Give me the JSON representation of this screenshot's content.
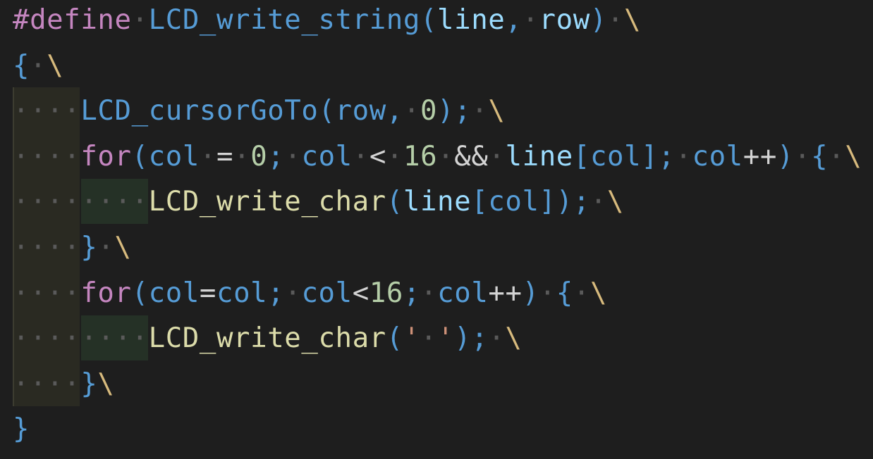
{
  "colors": {
    "background": "#1e1e1e",
    "keyword": "#c586c0",
    "function": "#dcdcaa",
    "variable": "#9cdcfe",
    "variable_alt": "#569cd6",
    "number": "#b5cea8",
    "string": "#ce9178",
    "operator": "#d4d4d4",
    "escape": "#d7ba7d",
    "whitespace_dot": "#5a5a5a",
    "indent_guide_1": "#2a2a22",
    "indent_guide_2": "#253126"
  },
  "code": {
    "lines": [
      {
        "tokens": [
          {
            "t": "#define",
            "c": "keyword"
          },
          {
            "t": "·",
            "c": "ws"
          },
          {
            "t": "LCD_write_string",
            "c": "variable_alt"
          },
          {
            "t": "(",
            "c": "variable_alt"
          },
          {
            "t": "line",
            "c": "variable"
          },
          {
            "t": ",",
            "c": "variable_alt"
          },
          {
            "t": "·",
            "c": "ws"
          },
          {
            "t": "row",
            "c": "variable"
          },
          {
            "t": ")",
            "c": "variable_alt"
          },
          {
            "t": "·",
            "c": "ws"
          },
          {
            "t": "\\",
            "c": "escape"
          }
        ]
      },
      {
        "tokens": [
          {
            "t": "{",
            "c": "variable_alt"
          },
          {
            "t": "·",
            "c": "ws"
          },
          {
            "t": "\\",
            "c": "escape"
          }
        ]
      },
      {
        "tokens": [
          {
            "t": "····",
            "c": "ws"
          },
          {
            "t": "LCD_cursorGoTo",
            "c": "variable_alt"
          },
          {
            "t": "(",
            "c": "variable_alt"
          },
          {
            "t": "row",
            "c": "variable_alt"
          },
          {
            "t": ",",
            "c": "variable_alt"
          },
          {
            "t": "·",
            "c": "ws"
          },
          {
            "t": "0",
            "c": "number"
          },
          {
            "t": ");",
            "c": "variable_alt"
          },
          {
            "t": "·",
            "c": "ws"
          },
          {
            "t": "\\",
            "c": "escape"
          }
        ]
      },
      {
        "tokens": [
          {
            "t": "····",
            "c": "ws"
          },
          {
            "t": "for",
            "c": "keyword"
          },
          {
            "t": "(",
            "c": "variable_alt"
          },
          {
            "t": "col",
            "c": "variable_alt"
          },
          {
            "t": "·",
            "c": "ws"
          },
          {
            "t": "=",
            "c": "operator"
          },
          {
            "t": "·",
            "c": "ws"
          },
          {
            "t": "0",
            "c": "number"
          },
          {
            "t": ";",
            "c": "variable_alt"
          },
          {
            "t": "·",
            "c": "ws"
          },
          {
            "t": "col",
            "c": "variable_alt"
          },
          {
            "t": "·",
            "c": "ws"
          },
          {
            "t": "<",
            "c": "operator"
          },
          {
            "t": "·",
            "c": "ws"
          },
          {
            "t": "16",
            "c": "number"
          },
          {
            "t": "·",
            "c": "ws"
          },
          {
            "t": "&&",
            "c": "operator"
          },
          {
            "t": "·",
            "c": "ws"
          },
          {
            "t": "line",
            "c": "variable"
          },
          {
            "t": "[",
            "c": "variable_alt"
          },
          {
            "t": "col",
            "c": "variable_alt"
          },
          {
            "t": "];",
            "c": "variable_alt"
          },
          {
            "t": "·",
            "c": "ws"
          },
          {
            "t": "col",
            "c": "variable_alt"
          },
          {
            "t": "++",
            "c": "operator"
          },
          {
            "t": ")",
            "c": "variable_alt"
          },
          {
            "t": "·",
            "c": "ws"
          },
          {
            "t": "{",
            "c": "variable_alt"
          },
          {
            "t": "·",
            "c": "ws"
          },
          {
            "t": "\\",
            "c": "escape"
          }
        ]
      },
      {
        "tokens": [
          {
            "t": "········",
            "c": "ws"
          },
          {
            "t": "LCD_write_char",
            "c": "function"
          },
          {
            "t": "(",
            "c": "variable_alt"
          },
          {
            "t": "line",
            "c": "variable"
          },
          {
            "t": "[",
            "c": "variable_alt"
          },
          {
            "t": "col",
            "c": "variable_alt"
          },
          {
            "t": "]);",
            "c": "variable_alt"
          },
          {
            "t": "·",
            "c": "ws"
          },
          {
            "t": "\\",
            "c": "escape"
          }
        ]
      },
      {
        "tokens": [
          {
            "t": "····",
            "c": "ws"
          },
          {
            "t": "}",
            "c": "variable_alt"
          },
          {
            "t": "·",
            "c": "ws"
          },
          {
            "t": "\\",
            "c": "escape"
          }
        ]
      },
      {
        "tokens": [
          {
            "t": "····",
            "c": "ws"
          },
          {
            "t": "for",
            "c": "keyword"
          },
          {
            "t": "(",
            "c": "variable_alt"
          },
          {
            "t": "col",
            "c": "variable_alt"
          },
          {
            "t": "=",
            "c": "operator"
          },
          {
            "t": "col",
            "c": "variable_alt"
          },
          {
            "t": ";",
            "c": "variable_alt"
          },
          {
            "t": "·",
            "c": "ws"
          },
          {
            "t": "col",
            "c": "variable_alt"
          },
          {
            "t": "<",
            "c": "operator"
          },
          {
            "t": "16",
            "c": "number"
          },
          {
            "t": ";",
            "c": "variable_alt"
          },
          {
            "t": "·",
            "c": "ws"
          },
          {
            "t": "col",
            "c": "variable_alt"
          },
          {
            "t": "++",
            "c": "operator"
          },
          {
            "t": ")",
            "c": "variable_alt"
          },
          {
            "t": "·",
            "c": "ws"
          },
          {
            "t": "{",
            "c": "variable_alt"
          },
          {
            "t": "·",
            "c": "ws"
          },
          {
            "t": "\\",
            "c": "escape"
          }
        ]
      },
      {
        "tokens": [
          {
            "t": "········",
            "c": "ws"
          },
          {
            "t": "LCD_write_char",
            "c": "function"
          },
          {
            "t": "(",
            "c": "variable_alt"
          },
          {
            "t": "'",
            "c": "string"
          },
          {
            "t": "·",
            "c": "ws"
          },
          {
            "t": "'",
            "c": "string"
          },
          {
            "t": ");",
            "c": "variable_alt"
          },
          {
            "t": "·",
            "c": "ws"
          },
          {
            "t": "\\",
            "c": "escape"
          }
        ]
      },
      {
        "tokens": [
          {
            "t": "····",
            "c": "ws"
          },
          {
            "t": "}",
            "c": "variable_alt"
          },
          {
            "t": "\\",
            "c": "escape"
          }
        ]
      },
      {
        "tokens": [
          {
            "t": "}",
            "c": "variable_alt"
          }
        ]
      }
    ]
  }
}
